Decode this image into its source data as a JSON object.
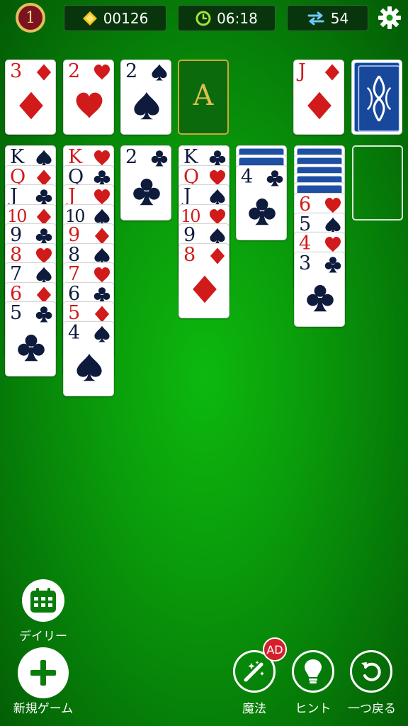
{
  "header": {
    "level": "1",
    "coins": "00126",
    "time": "06:18",
    "moves": "54",
    "colors": {
      "coin": "#f5c518",
      "clock": "#a4e33a",
      "moves": "#6ec8ff"
    }
  },
  "foundations": [
    {
      "rank": "3",
      "suit": "diamond",
      "color": "red"
    },
    {
      "rank": "2",
      "suit": "heart",
      "color": "red"
    },
    {
      "rank": "2",
      "suit": "spade",
      "color": "black"
    },
    {
      "placeholder": "A"
    }
  ],
  "waste": {
    "rank": "J",
    "suit": "diamond",
    "color": "red"
  },
  "stock": {
    "face_down": true
  },
  "tableau": [
    {
      "face_down": 0,
      "cards": [
        {
          "rank": "K",
          "suit": "spade",
          "color": "black"
        },
        {
          "rank": "Q",
          "suit": "diamond",
          "color": "red"
        },
        {
          "rank": "J",
          "suit": "club",
          "color": "black"
        },
        {
          "rank": "10",
          "suit": "diamond",
          "color": "red"
        },
        {
          "rank": "9",
          "suit": "club",
          "color": "black"
        },
        {
          "rank": "8",
          "suit": "heart",
          "color": "red"
        },
        {
          "rank": "7",
          "suit": "spade",
          "color": "black"
        },
        {
          "rank": "6",
          "suit": "diamond",
          "color": "red"
        },
        {
          "rank": "5",
          "suit": "club",
          "color": "black"
        }
      ]
    },
    {
      "face_down": 0,
      "cards": [
        {
          "rank": "K",
          "suit": "heart",
          "color": "red"
        },
        {
          "rank": "Q",
          "suit": "club",
          "color": "black"
        },
        {
          "rank": "J",
          "suit": "heart",
          "color": "red"
        },
        {
          "rank": "10",
          "suit": "spade",
          "color": "black"
        },
        {
          "rank": "9",
          "suit": "diamond",
          "color": "red"
        },
        {
          "rank": "8",
          "suit": "spade",
          "color": "black"
        },
        {
          "rank": "7",
          "suit": "heart",
          "color": "red"
        },
        {
          "rank": "6",
          "suit": "club",
          "color": "black"
        },
        {
          "rank": "5",
          "suit": "diamond",
          "color": "red"
        },
        {
          "rank": "4",
          "suit": "spade",
          "color": "black"
        }
      ]
    },
    {
      "face_down": 0,
      "cards": [
        {
          "rank": "2",
          "suit": "club",
          "color": "black"
        }
      ]
    },
    {
      "face_down": 0,
      "cards": [
        {
          "rank": "K",
          "suit": "club",
          "color": "black"
        },
        {
          "rank": "Q",
          "suit": "heart",
          "color": "red"
        },
        {
          "rank": "J",
          "suit": "spade",
          "color": "black"
        },
        {
          "rank": "10",
          "suit": "heart",
          "color": "red"
        },
        {
          "rank": "9",
          "suit": "spade",
          "color": "black"
        },
        {
          "rank": "8",
          "suit": "diamond",
          "color": "red"
        }
      ]
    },
    {
      "face_down": 2,
      "cards": [
        {
          "rank": "4",
          "suit": "club",
          "color": "black"
        }
      ]
    },
    {
      "face_down": 5,
      "cards": [
        {
          "rank": "6",
          "suit": "heart",
          "color": "red"
        },
        {
          "rank": "5",
          "suit": "spade",
          "color": "black"
        },
        {
          "rank": "4",
          "suit": "heart",
          "color": "red"
        },
        {
          "rank": "3",
          "suit": "club",
          "color": "black"
        }
      ]
    },
    {
      "face_down": 0,
      "cards": []
    }
  ],
  "buttons": {
    "daily": "デイリー",
    "new_game": "新規ゲーム",
    "magic": "魔法",
    "magic_badge": "AD",
    "hint": "ヒント",
    "undo": "一つ戻る"
  }
}
